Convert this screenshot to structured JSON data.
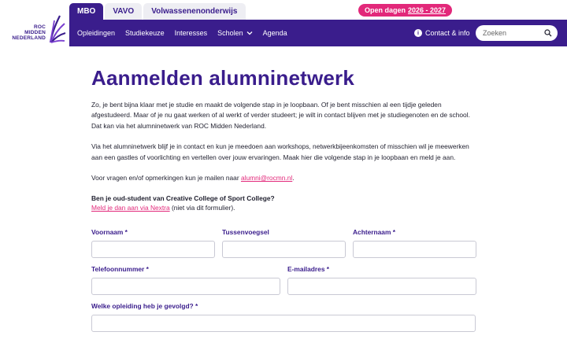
{
  "logo": {
    "line1": "ROC",
    "line2": "MIDDEN",
    "line3": "NEDERLAND"
  },
  "segment_tabs": [
    {
      "label": "MBO"
    },
    {
      "label": "VAVO"
    },
    {
      "label": "Volwassenenonderwijs"
    }
  ],
  "open_days": {
    "prefix": "Open dagen",
    "years": "2026 - 2027"
  },
  "nav": {
    "items": [
      {
        "label": "Opleidingen"
      },
      {
        "label": "Studiekeuze"
      },
      {
        "label": "Interesses"
      },
      {
        "label": "Scholen"
      },
      {
        "label": "Agenda"
      }
    ],
    "contact_label": "Contact & info",
    "search_placeholder": "Zoeken"
  },
  "main": {
    "title": "Aanmelden alumninetwerk",
    "paragraph1": "Zo, je bent bijna klaar met je studie en maakt de volgende stap in je loopbaan. Of je bent misschien al een tijdje geleden afgestudeerd. Maar of je nu gaat werken of al werkt of verder studeert; je wilt in contact blijven met je studiegenoten en de school. Dat kan via het alumninetwerk van ROC Midden Nederland.",
    "paragraph2": "Via het alumninetwerk blijf je in contact en kun je meedoen aan workshops, netwerkbijeenkomsten of misschien wil je meewerken aan een gastles of voorlichting en vertellen over jouw ervaringen. Maak hier die volgende stap in je loopbaan en meld je aan.",
    "questions_prefix": "Voor vragen en/of opmerkingen kun je mailen naar ",
    "questions_email": "alumni@rocmn.nl",
    "questions_suffix": ".",
    "oud_student_question": "Ben je oud-student van Creative College of Sport College?",
    "nextra_link": "Meld je dan aan via Nextra",
    "nextra_suffix": " (niet via dit formulier)."
  },
  "form": {
    "voornaam_label": "Voornaam *",
    "tussenvoegsel_label": "Tussenvoegsel",
    "achternaam_label": "Achternaam *",
    "telefoon_label": "Telefoonnummer *",
    "email_label": "E-mailadres *",
    "opleiding_label": "Welke opleiding heb je gevolgd? *"
  },
  "colors": {
    "brand_purple": "#3a1d8c",
    "accent_pink": "#e2287a"
  }
}
